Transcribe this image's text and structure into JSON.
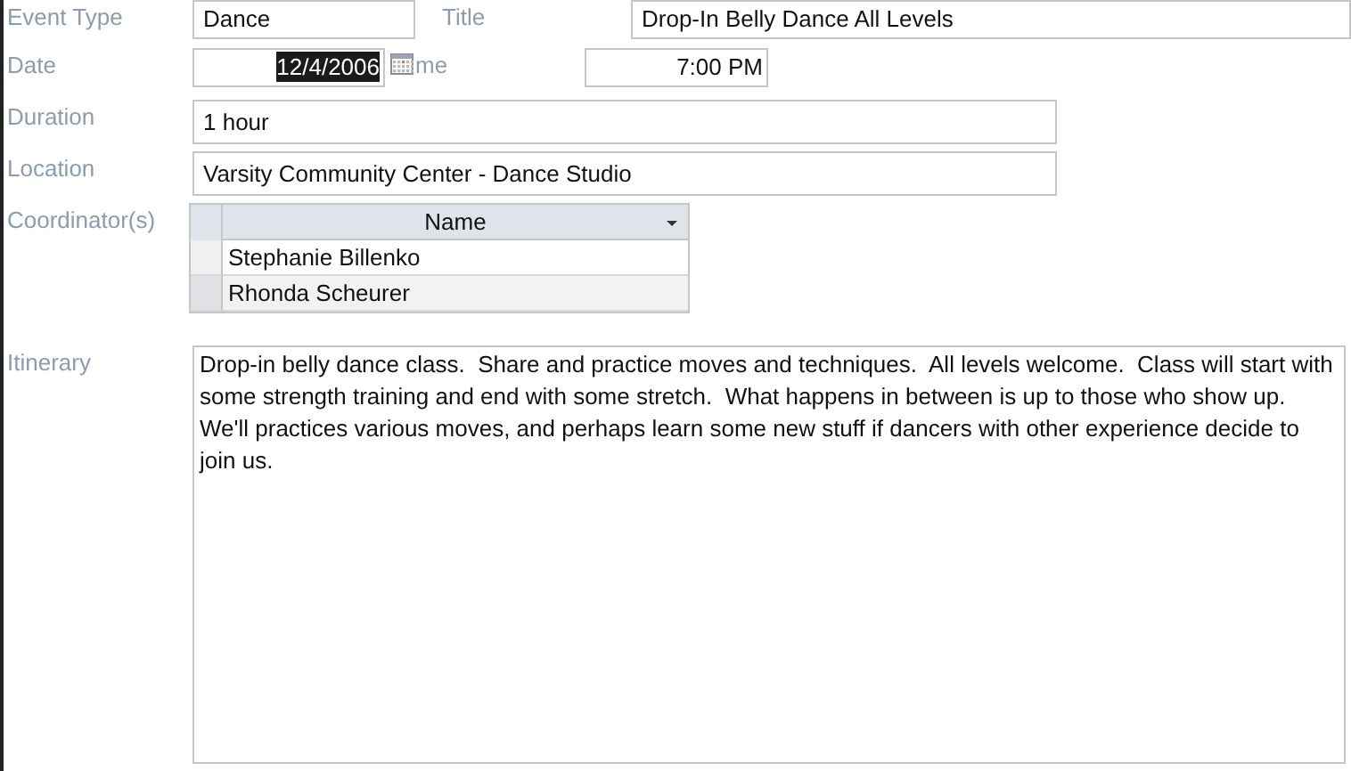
{
  "event_type": {
    "label": "Event Type",
    "value": "Dance"
  },
  "title": {
    "label": "Title",
    "value": "Drop-In Belly Dance All Levels"
  },
  "date": {
    "label": "Date",
    "value": "12/4/2006",
    "text_selected": true
  },
  "time": {
    "label": "me",
    "value": "7:00 PM"
  },
  "duration": {
    "label": "Duration",
    "value": "1 hour"
  },
  "location": {
    "label": "Location",
    "value": "Varsity Community Center - Dance Studio"
  },
  "coordinators": {
    "label": "Coordinator(s)",
    "column": "Name",
    "rows": [
      "Stephanie Billenko",
      "Rhonda Scheurer"
    ]
  },
  "itinerary": {
    "label": "Itinerary",
    "value": "Drop-in belly dance class.  Share and practice moves and techniques.  All levels welcome.  Class will start with some strength training and end with some stretch.  What happens in between is up to those who show up.  We'll practices various moves, and perhaps learn some new stuff if dancers with other experience decide to join us."
  }
}
